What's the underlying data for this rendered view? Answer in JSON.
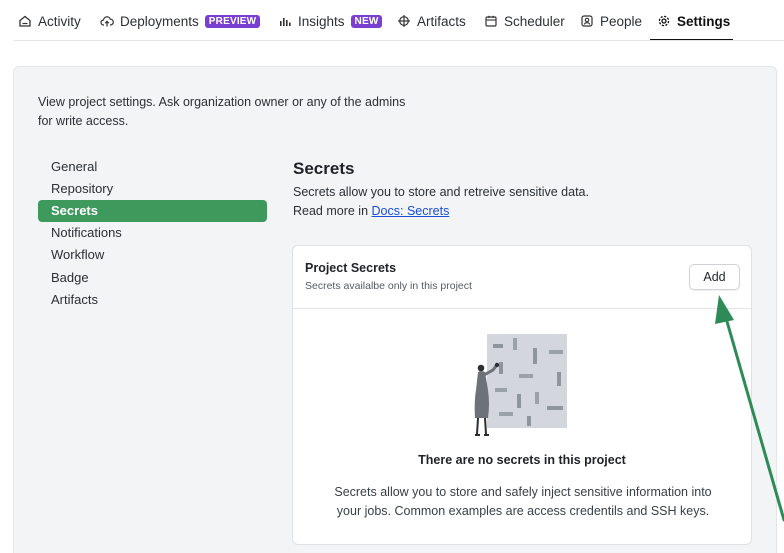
{
  "tabs": [
    {
      "label": "Activity",
      "icon": "home-icon"
    },
    {
      "label": "Deployments",
      "icon": "cloud-upload-icon",
      "badge": "PREVIEW"
    },
    {
      "label": "Insights",
      "icon": "bar-chart-icon",
      "badge": "NEW"
    },
    {
      "label": "Artifacts",
      "icon": "artifacts-icon"
    },
    {
      "label": "Scheduler",
      "icon": "calendar-icon"
    },
    {
      "label": "People",
      "icon": "person-badge-icon"
    },
    {
      "label": "Settings",
      "icon": "gear-icon",
      "active": true
    }
  ],
  "intro": "View project settings. Ask organization owner or any of the admins for write access.",
  "menu": {
    "items": [
      "General",
      "Repository",
      "Secrets",
      "Notifications",
      "Workflow",
      "Badge",
      "Artifacts"
    ],
    "active": "Secrets"
  },
  "secrets": {
    "title": "Secrets",
    "description": "Secrets allow you to store and retreive sensitive data.",
    "read_more_prefix": "Read more in",
    "docs_link": "Docs: Secrets"
  },
  "card": {
    "title": "Project Secrets",
    "subtitle": "Secrets availalbe only in this project",
    "add_label": "Add",
    "empty_title": "There are no secrets in this project",
    "empty_description": "Secrets allow you to store and safely inject sensitive information into your jobs. Common examples are access credentils and SSH keys."
  },
  "colors": {
    "active_menu": "#3d9a5c",
    "badge": "#7a3fd1",
    "link": "#1a4fd6",
    "arrow": "#2e8b57"
  }
}
